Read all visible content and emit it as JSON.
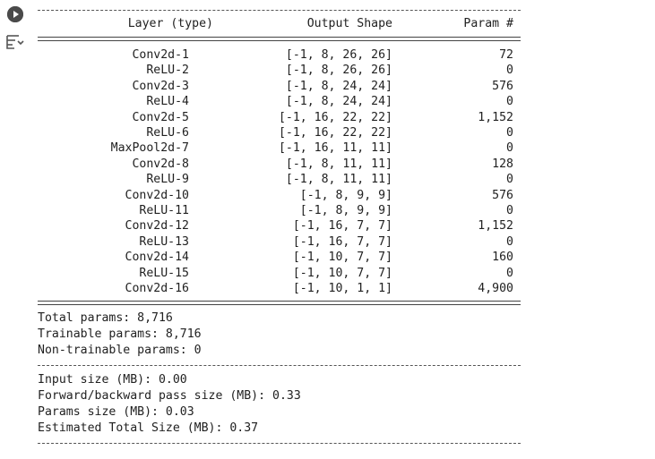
{
  "cell": {
    "run_icon": "play-circle-icon",
    "output_menu_icon": "output-menu-icon"
  },
  "summary": {
    "headers": {
      "layer": "Layer (type)",
      "shape": "Output Shape",
      "params": "Param #"
    },
    "rows": [
      {
        "layer": "Conv2d-1",
        "shape": "[-1, 8, 26, 26]",
        "params": "72"
      },
      {
        "layer": "ReLU-2",
        "shape": "[-1, 8, 26, 26]",
        "params": "0"
      },
      {
        "layer": "Conv2d-3",
        "shape": "[-1, 8, 24, 24]",
        "params": "576"
      },
      {
        "layer": "ReLU-4",
        "shape": "[-1, 8, 24, 24]",
        "params": "0"
      },
      {
        "layer": "Conv2d-5",
        "shape": "[-1, 16, 22, 22]",
        "params": "1,152"
      },
      {
        "layer": "ReLU-6",
        "shape": "[-1, 16, 22, 22]",
        "params": "0"
      },
      {
        "layer": "MaxPool2d-7",
        "shape": "[-1, 16, 11, 11]",
        "params": "0"
      },
      {
        "layer": "Conv2d-8",
        "shape": "[-1, 8, 11, 11]",
        "params": "128"
      },
      {
        "layer": "ReLU-9",
        "shape": "[-1, 8, 11, 11]",
        "params": "0"
      },
      {
        "layer": "Conv2d-10",
        "shape": "[-1, 8, 9, 9]",
        "params": "576"
      },
      {
        "layer": "ReLU-11",
        "shape": "[-1, 8, 9, 9]",
        "params": "0"
      },
      {
        "layer": "Conv2d-12",
        "shape": "[-1, 16, 7, 7]",
        "params": "1,152"
      },
      {
        "layer": "ReLU-13",
        "shape": "[-1, 16, 7, 7]",
        "params": "0"
      },
      {
        "layer": "Conv2d-14",
        "shape": "[-1, 10, 7, 7]",
        "params": "160"
      },
      {
        "layer": "ReLU-15",
        "shape": "[-1, 10, 7, 7]",
        "params": "0"
      },
      {
        "layer": "Conv2d-16",
        "shape": "[-1, 10, 1, 1]",
        "params": "4,900"
      }
    ],
    "totals": {
      "total": "Total params: 8,716",
      "trainable": "Trainable params: 8,716",
      "non_trainable": "Non-trainable params: 0"
    },
    "sizes": {
      "input": "Input size (MB): 0.00",
      "forward_backward": "Forward/backward pass size (MB): 0.33",
      "params": "Params size (MB): 0.03",
      "estimated_total": "Estimated Total Size (MB): 0.37"
    }
  }
}
